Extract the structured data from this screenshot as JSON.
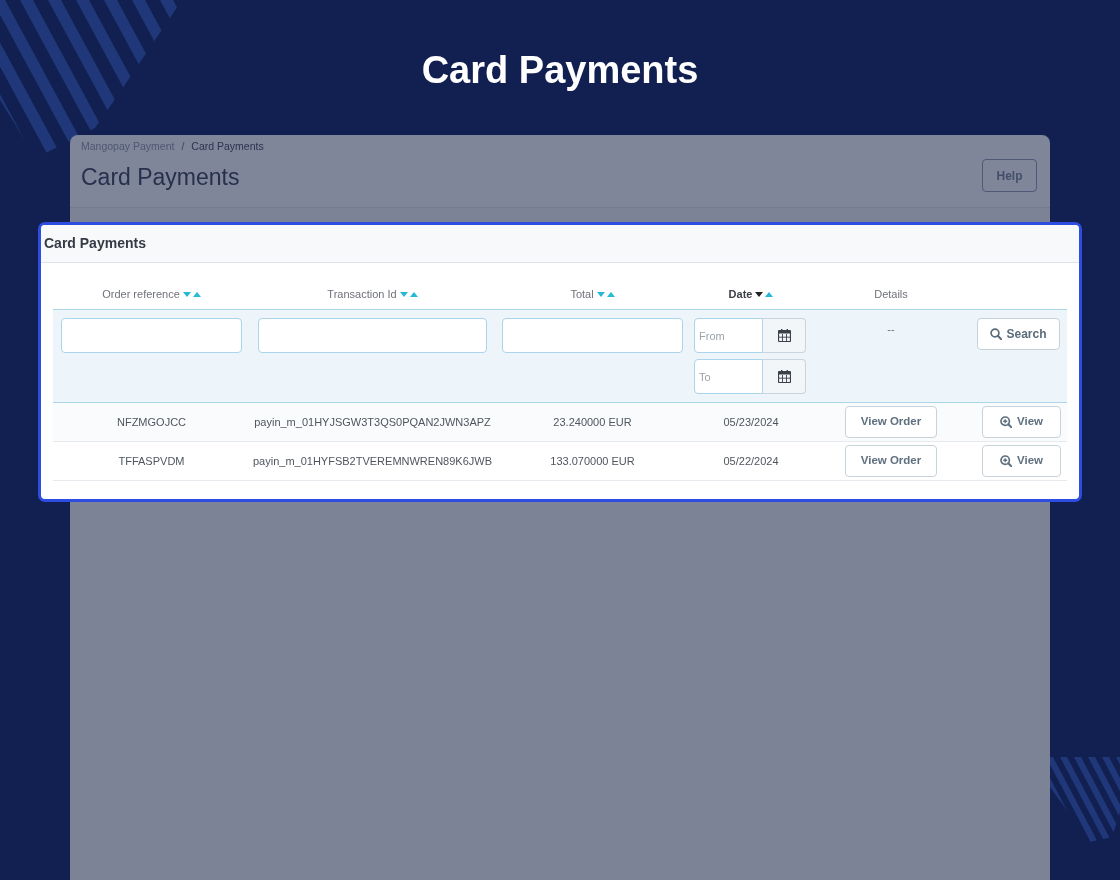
{
  "hero": {
    "title": "Card Payments"
  },
  "page": {
    "breadcrumb": [
      {
        "label": "Mangopay Payment",
        "current": false
      },
      {
        "label": "Card Payments",
        "current": true
      }
    ],
    "breadcrumb_separator": "/",
    "title": "Card Payments",
    "help_button": "Help"
  },
  "panel": {
    "title": "Card Payments",
    "table": {
      "columns": [
        {
          "label": "Order reference",
          "sortable": true,
          "sorted": false
        },
        {
          "label": "Transaction Id",
          "sortable": true,
          "sorted": false
        },
        {
          "label": "Total",
          "sortable": true,
          "sorted": false
        },
        {
          "label": "Date",
          "sortable": true,
          "sorted": true
        },
        {
          "label": "Details",
          "sortable": false,
          "sorted": false
        }
      ],
      "filters": [
        {
          "kind": "text"
        },
        {
          "kind": "text"
        },
        {
          "kind": "text"
        },
        {
          "kind": "date_range",
          "from_placeholder": "From",
          "to_placeholder": "To"
        },
        {
          "kind": "label",
          "text": "--"
        },
        {
          "kind": "button",
          "label": "Search"
        }
      ],
      "rows": [
        {
          "order_reference": "NFZMGOJCC",
          "transaction_id": "payin_m_01HYJSGW3T3QS0PQAN2JWN3APZ",
          "total": "23.240000 EUR",
          "date": "05/23/2024",
          "order_button": "View Order",
          "view_button": "View"
        },
        {
          "order_reference": "TFFASPVDM",
          "transaction_id": "payin_m_01HYFSB2TVEREMNWREN89K6JWB",
          "total": "133.070000 EUR",
          "date": "05/22/2024",
          "order_button": "View Order",
          "view_button": "View"
        }
      ]
    }
  }
}
